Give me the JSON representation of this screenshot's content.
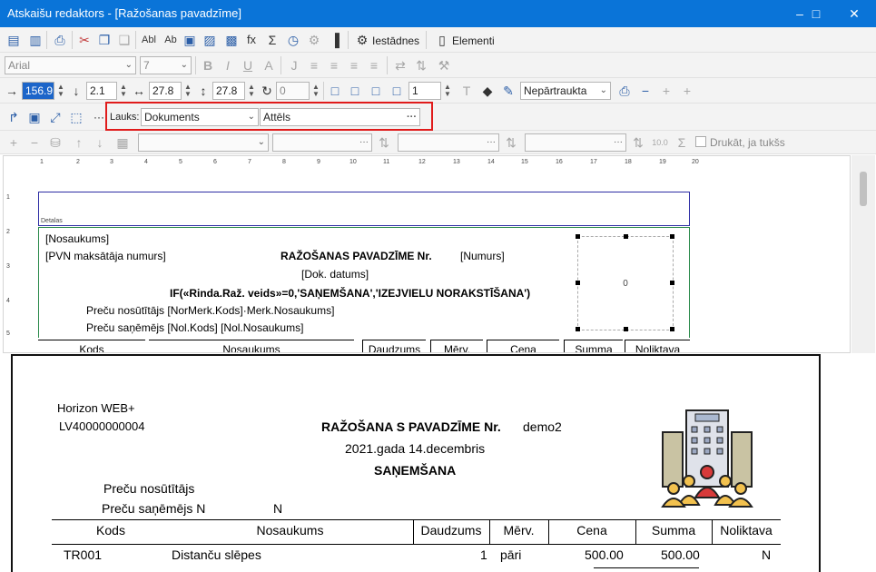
{
  "window": {
    "title": "Atskaišu redaktors - [Ražošanas pavadzīme]"
  },
  "toolbar1": {
    "settings_label": "Iestādnes",
    "elements_label": "Elementi"
  },
  "toolbar2": {
    "font_family": "Arial",
    "font_size": "7"
  },
  "toolbar3": {
    "left": "156.9",
    "top": "2.1",
    "width": "27.8",
    "height": "27.8",
    "rotation": "0",
    "border_width": "1",
    "border_style": "Nepārtraukta"
  },
  "toolbar4": {
    "field_label": "Lauks:",
    "field_value": "Dokuments",
    "field_type": "Attēls",
    "more": "···"
  },
  "toolbar5": {
    "print_if_empty": "Drukāt, ja tukšs"
  },
  "ruler": {
    "h": [
      "1",
      "2",
      "3",
      "4",
      "5",
      "6",
      "7",
      "8",
      "9",
      "10",
      "11",
      "12",
      "13",
      "14",
      "15",
      "16",
      "17",
      "18",
      "19",
      "20"
    ],
    "v": [
      "1",
      "2",
      "3",
      "4",
      "5"
    ]
  },
  "design": {
    "band_details": "Detalas",
    "nosaukums": "[Nosaukums]",
    "pvn": "[PVN maksātāja numurs]",
    "title": "RAŽOŠANAS PAVADZĪME Nr.",
    "numurs": "[Numurs]",
    "date": "[Dok. datums]",
    "if_expr": "IF(«Rinda.Raž. veids»=0,'SAŅEMŠANA','IZEJVIELU NORAKSTĪŠANA')",
    "sender": "Preču nosūtītājs [NorMerk.Kods]·Merk.Nosaukums]",
    "receiver": "Preču saņēmējs [Nol.Kods]  [Nol.Nosaukums]",
    "image_value": "0",
    "columns": [
      "Kods",
      "Nosaukums",
      "Daudzums",
      "Mērv.",
      "Cena",
      "Summa",
      "Noliktava"
    ]
  },
  "preview": {
    "company": "Horizon WEB+",
    "reg_no": "LV40000000004",
    "title": "RAŽOŠANA S PAVADZĪME Nr.",
    "doc_no": "demo2",
    "date": "2021.gada 14.decembris",
    "type": "SAŅEMŠANA",
    "sender": "Preču nosūtītājs",
    "receiver": "Preču saņēmējs N",
    "receiver_name": "N",
    "columns": [
      "Kods",
      "Nosaukums",
      "Daudzums",
      "Mērv.",
      "Cena",
      "Summa",
      "Noliktava"
    ],
    "rows": [
      {
        "kods": "TR001",
        "nosaukums": "Distanču slēpes",
        "daudzums": "1",
        "merv": "pāri",
        "cena": "500.00",
        "summa": "500.00",
        "noliktava": "N"
      }
    ]
  },
  "colors": {
    "titlebar": "#0a74d8",
    "highlight": "#e01b1b",
    "band_blue": "#2c2ca4",
    "band_green": "#2a8a4a"
  }
}
